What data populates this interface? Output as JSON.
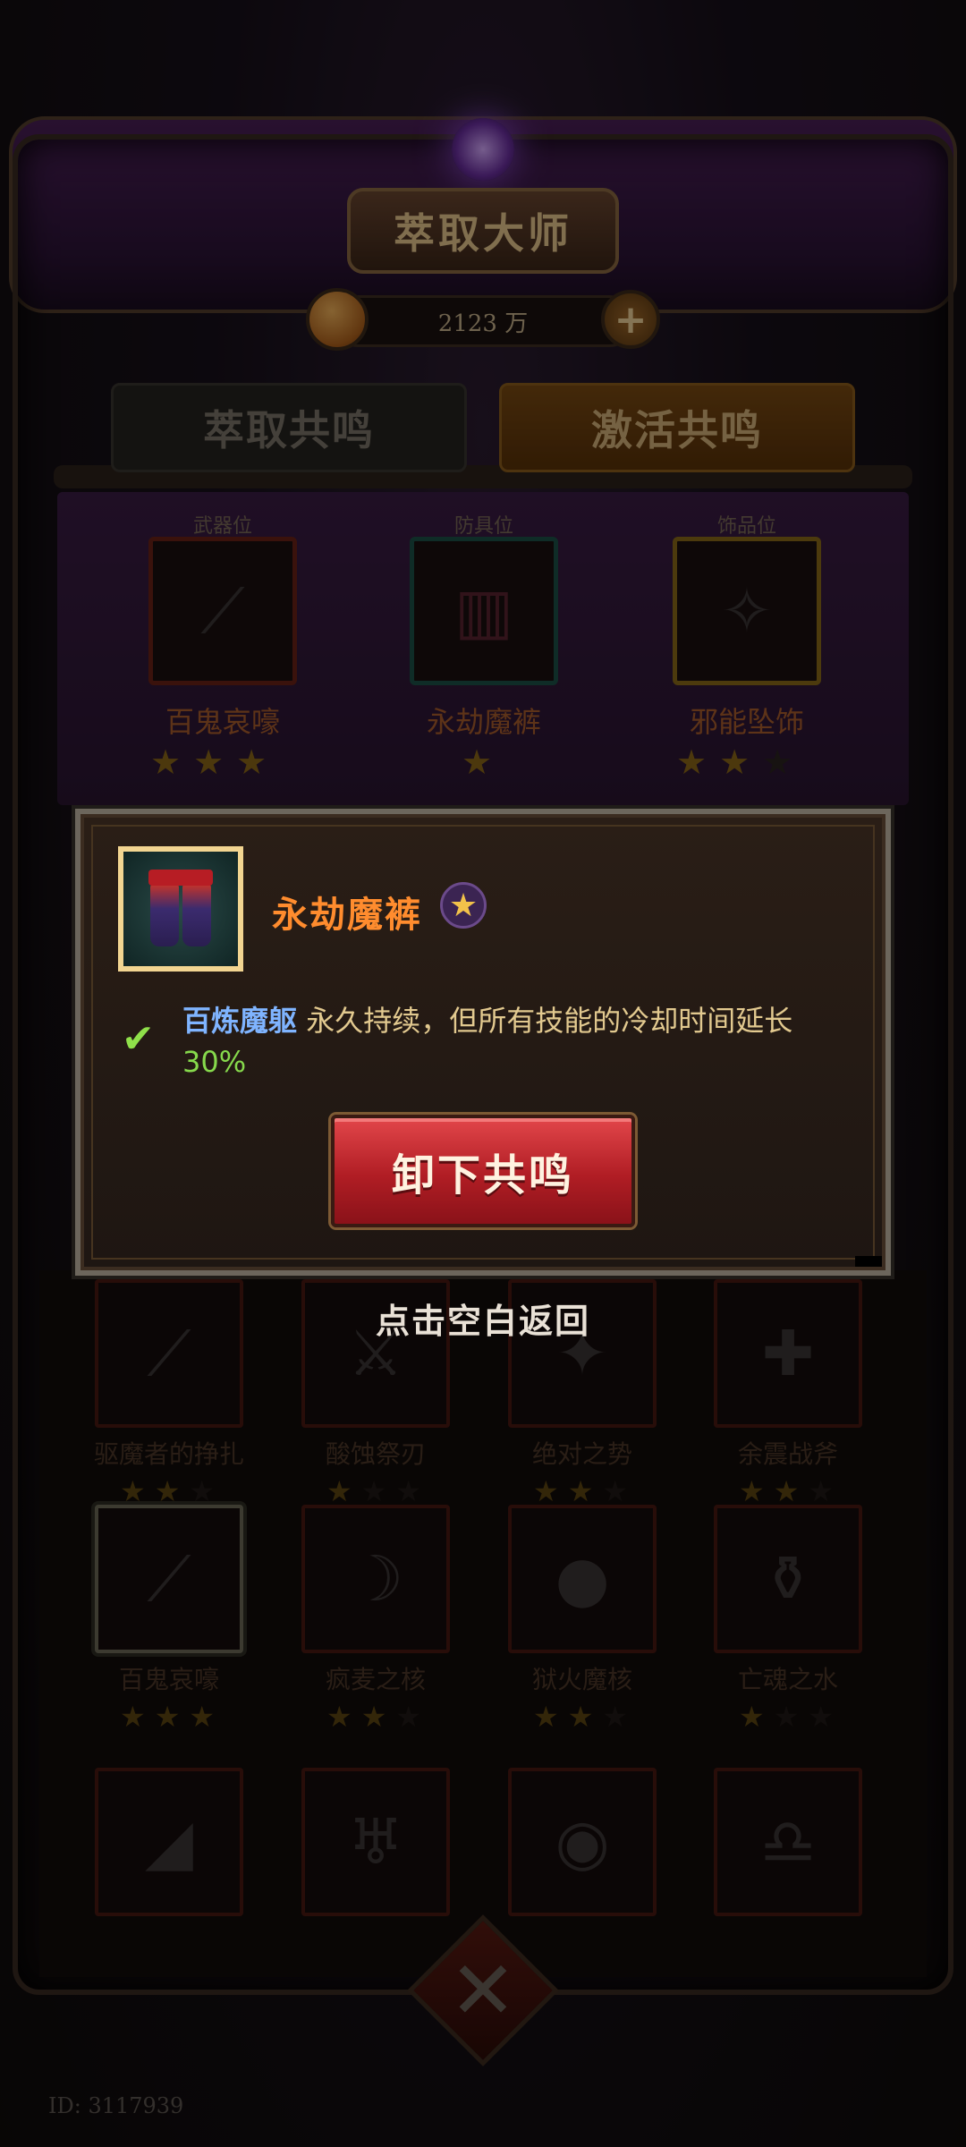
{
  "header": {
    "title": "萃取大师",
    "currency_amount": "2123 万",
    "currency_icon": "coin-icon",
    "add_icon": "plus-icon"
  },
  "tabs": [
    {
      "label": "萃取共鸣",
      "active": false
    },
    {
      "label": "激活共鸣",
      "active": true
    }
  ],
  "slots": [
    {
      "caption": "武器位",
      "name": "百鬼哀嚎",
      "stars": 3,
      "max_stars": 3,
      "border": "#6a2216"
    },
    {
      "caption": "防具位",
      "name": "永劫魔裤",
      "stars": 1,
      "max_stars": 1,
      "border": "#1d5047"
    },
    {
      "caption": "饰品位",
      "name": "邪能坠饰",
      "stars": 2,
      "max_stars": 3,
      "border": "#8a6a18"
    }
  ],
  "inventory": [
    {
      "name": "驱魔者的挣扎",
      "stars": 2,
      "glyph": "dagger"
    },
    {
      "name": "酸蚀祭刃",
      "stars": 1,
      "glyph": "blade"
    },
    {
      "name": "绝对之势",
      "stars": 2,
      "glyph": "spike"
    },
    {
      "name": "余震战斧",
      "stars": 2,
      "glyph": "axe"
    },
    {
      "name": "百鬼哀嚎",
      "stars": 3,
      "glyph": "staff",
      "selected": true
    },
    {
      "name": "疯麦之核",
      "stars": 2,
      "glyph": "scythe"
    },
    {
      "name": "狱火魔核",
      "stars": 2,
      "glyph": "orb"
    },
    {
      "name": "亡魂之水",
      "stars": 1,
      "glyph": "flask"
    },
    {
      "name": "",
      "stars": 0,
      "glyph": "trowel"
    },
    {
      "name": "",
      "stars": 0,
      "glyph": "goblet"
    },
    {
      "name": "",
      "stars": 0,
      "glyph": "crystal"
    },
    {
      "name": "",
      "stars": 0,
      "glyph": "bell"
    }
  ],
  "modal": {
    "item_name": "永劫魔裤",
    "quality_stars": 1,
    "effect_name": "百炼魔躯",
    "effect_text": "永久持续，但所有技能的冷却时间延长",
    "effect_value": "30%",
    "button_label": "卸下共鸣",
    "accent_color": "#ff8c2e"
  },
  "tap_return": "点击空白返回",
  "player_id": "ID: 3117939"
}
